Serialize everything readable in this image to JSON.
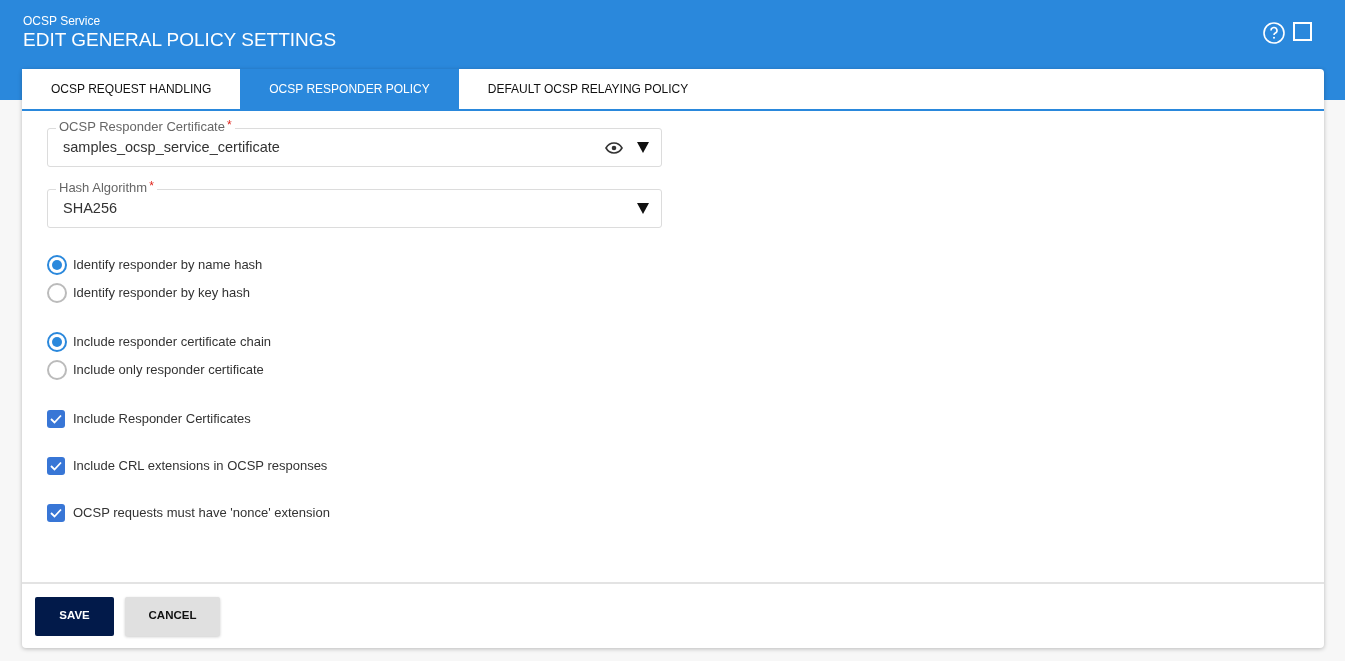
{
  "header": {
    "subtitle": "OCSP Service",
    "title": "EDIT GENERAL POLICY SETTINGS"
  },
  "tabs": [
    {
      "label": "OCSP REQUEST HANDLING",
      "selected": false
    },
    {
      "label": "OCSP RESPONDER POLICY",
      "selected": true
    },
    {
      "label": "DEFAULT OCSP RELAYING POLICY",
      "selected": false
    }
  ],
  "fields": [
    {
      "label": "OCSP Responder Certificate",
      "required_mark": "*",
      "value": "samples_ocsp_service_certificate",
      "has_view": true
    },
    {
      "label": "Hash Algorithm",
      "required_mark": "*",
      "value": "SHA256",
      "has_view": false
    }
  ],
  "radio_groups": [
    [
      {
        "label": "Identify responder by name hash",
        "selected": true
      },
      {
        "label": "Identify responder by key hash",
        "selected": false
      }
    ],
    [
      {
        "label": "Include responder certificate chain",
        "selected": true
      },
      {
        "label": "Include only responder certificate",
        "selected": false
      }
    ]
  ],
  "checkboxes": [
    {
      "label": "Include Responder Certificates",
      "checked": true
    },
    {
      "label": "Include CRL extensions in OCSP responses",
      "checked": true
    },
    {
      "label": "OCSP requests must have 'nonce' extension",
      "checked": true
    }
  ],
  "buttons": [
    {
      "label": "SAVE",
      "kind": "primary"
    },
    {
      "label": "CANCEL",
      "kind": "secondary"
    }
  ]
}
